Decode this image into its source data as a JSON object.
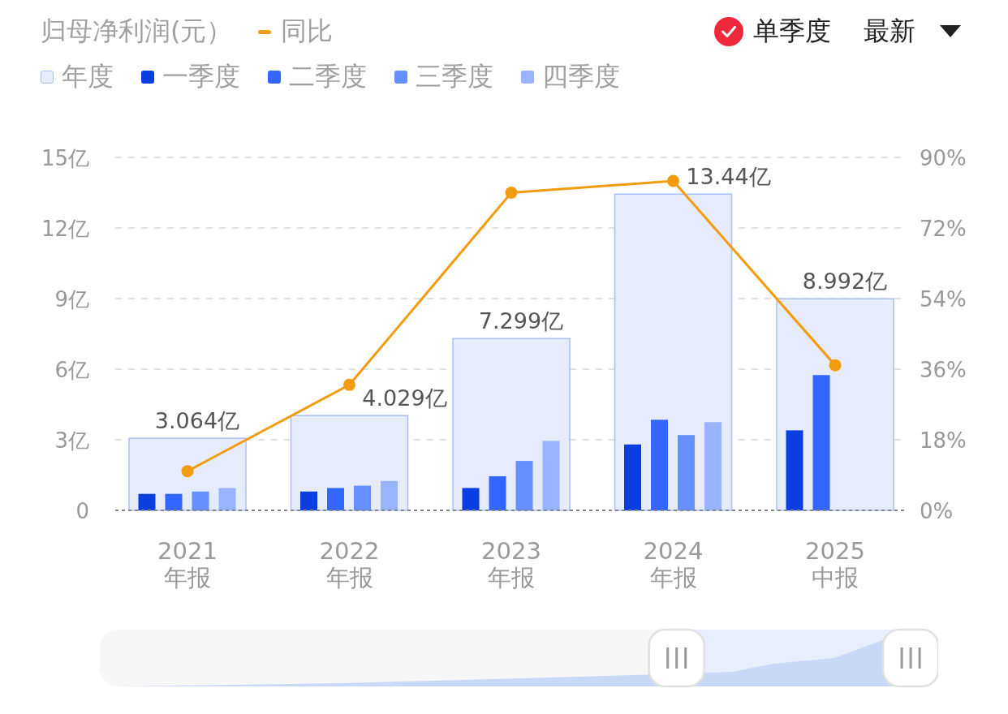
{
  "header": {
    "title": "归母净利润(元）",
    "single_quarter": {
      "label": "单季度",
      "checked": true
    },
    "period_dropdown": {
      "value": "最新"
    }
  },
  "chart": {
    "chart_data": {
      "type": "bar",
      "grid": true,
      "categories": [
        "2021\n年报",
        "2022\n年报",
        "2023\n年报",
        "2024\n年报",
        "2025\n中报"
      ],
      "series": [
        {
          "name": "年度",
          "color": "#e6ecfc",
          "values": [
            3.064,
            4.029,
            7.299,
            13.44,
            8.992
          ]
        },
        {
          "name": "一季度",
          "color": "#0a3ee0",
          "values": [
            0.7,
            0.8,
            0.95,
            2.8,
            3.4
          ]
        },
        {
          "name": "二季度",
          "color": "#3366ff",
          "values": [
            0.7,
            0.95,
            1.45,
            3.85,
            5.75
          ]
        },
        {
          "name": "三季度",
          "color": "#6690ff",
          "values": [
            0.8,
            1.05,
            2.1,
            3.2,
            null
          ]
        },
        {
          "name": "四季度",
          "color": "#99b3ff",
          "values": [
            0.95,
            1.25,
            2.95,
            3.75,
            null
          ]
        }
      ],
      "value_labels": [
        "3.064亿",
        "4.029亿",
        "7.299亿",
        "13.44亿",
        "8.992亿"
      ],
      "ylim": [
        0,
        15
      ],
      "yticks": [
        {
          "value": 0,
          "label": "0"
        },
        {
          "value": 3,
          "label": "3亿"
        },
        {
          "value": 6,
          "label": "6亿"
        },
        {
          "value": 9,
          "label": "9亿"
        },
        {
          "value": 12,
          "label": "12亿"
        },
        {
          "value": 15,
          "label": "15亿"
        }
      ]
    }
  },
  "yoy_chart": {
    "chart_data": {
      "type": "line",
      "series": [
        {
          "name": "同比",
          "color": "#f39c12",
          "marker": true,
          "values": [
            10,
            32,
            81,
            84,
            37
          ]
        }
      ],
      "ylim": [
        0,
        90
      ],
      "yticks": [
        {
          "value": 0,
          "label": "0%"
        },
        {
          "value": 18,
          "label": "18%"
        },
        {
          "value": 36,
          "label": "36%"
        },
        {
          "value": 54,
          "label": "54%"
        },
        {
          "value": 72,
          "label": "72%"
        },
        {
          "value": 90,
          "label": "90%"
        }
      ]
    }
  },
  "range_slider": {
    "start": {
      "level": 0.69
    },
    "end": {
      "level": 0.97
    }
  }
}
